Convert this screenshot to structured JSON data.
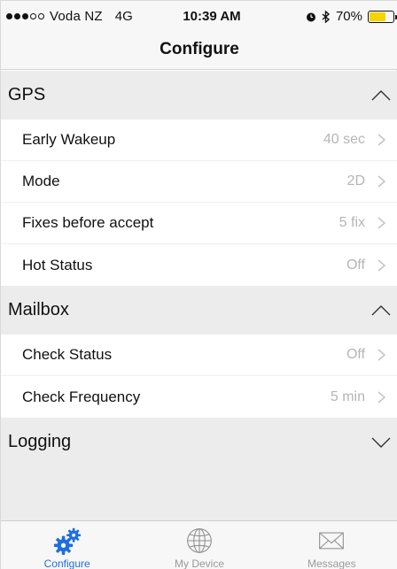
{
  "status_bar": {
    "carrier": "Voda NZ",
    "network": "4G",
    "time": "10:39 AM",
    "battery": "70%",
    "battery_level": 0.7,
    "signal_bars_filled": 3,
    "signal_bars_total": 5,
    "battery_color": "#f5d400"
  },
  "nav": {
    "title": "Configure"
  },
  "sections": [
    {
      "title": "GPS",
      "expanded": true,
      "chevron_icon": "chevron-up-icon",
      "rows": [
        {
          "label": "Early Wakeup",
          "value": "40 sec"
        },
        {
          "label": "Mode",
          "value": "2D"
        },
        {
          "label": "Fixes before accept",
          "value": "5 fix"
        },
        {
          "label": "Hot Status",
          "value": "Off"
        }
      ]
    },
    {
      "title": "Mailbox",
      "expanded": true,
      "chevron_icon": "chevron-up-icon",
      "rows": [
        {
          "label": "Check Status",
          "value": "Off"
        },
        {
          "label": "Check Frequency",
          "value": "5 min"
        }
      ]
    },
    {
      "title": "Logging",
      "expanded": false,
      "chevron_icon": "chevron-down-icon",
      "rows": []
    }
  ],
  "tabs": [
    {
      "label": "Configure",
      "icon": "gears-icon",
      "active": true
    },
    {
      "label": "My Device",
      "icon": "globe-icon",
      "active": false
    },
    {
      "label": "Messages",
      "icon": "envelope-icon",
      "active": false
    }
  ],
  "colors": {
    "accent": "#1d6fe0",
    "section_background": "#ececec",
    "row_value": "#b5b5b5",
    "inactive_tab": "#9a9a9a"
  }
}
